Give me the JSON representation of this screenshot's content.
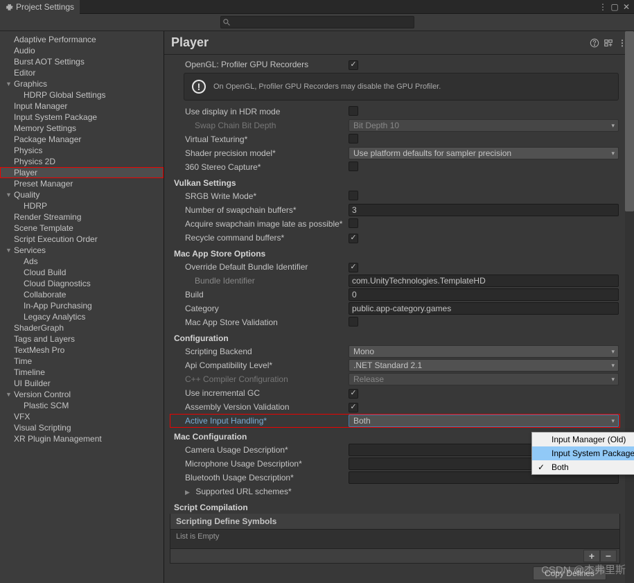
{
  "window": {
    "title": "Project Settings"
  },
  "search": {
    "placeholder": ""
  },
  "sidebar": {
    "items": [
      {
        "label": "Adaptive Performance",
        "indent": 0
      },
      {
        "label": "Audio",
        "indent": 0
      },
      {
        "label": "Burst AOT Settings",
        "indent": 0
      },
      {
        "label": "Editor",
        "indent": 0
      },
      {
        "label": "Graphics",
        "indent": 0,
        "expandable": true
      },
      {
        "label": "HDRP Global Settings",
        "indent": 1
      },
      {
        "label": "Input Manager",
        "indent": 0
      },
      {
        "label": "Input System Package",
        "indent": 0
      },
      {
        "label": "Memory Settings",
        "indent": 0
      },
      {
        "label": "Package Manager",
        "indent": 0
      },
      {
        "label": "Physics",
        "indent": 0
      },
      {
        "label": "Physics 2D",
        "indent": 0
      },
      {
        "label": "Player",
        "indent": 0,
        "selected": true,
        "redbox": true
      },
      {
        "label": "Preset Manager",
        "indent": 0
      },
      {
        "label": "Quality",
        "indent": 0,
        "expandable": true
      },
      {
        "label": "HDRP",
        "indent": 1
      },
      {
        "label": "Render Streaming",
        "indent": 0
      },
      {
        "label": "Scene Template",
        "indent": 0
      },
      {
        "label": "Script Execution Order",
        "indent": 0
      },
      {
        "label": "Services",
        "indent": 0,
        "expandable": true
      },
      {
        "label": "Ads",
        "indent": 1
      },
      {
        "label": "Cloud Build",
        "indent": 1
      },
      {
        "label": "Cloud Diagnostics",
        "indent": 1
      },
      {
        "label": "Collaborate",
        "indent": 1
      },
      {
        "label": "In-App Purchasing",
        "indent": 1
      },
      {
        "label": "Legacy Analytics",
        "indent": 1
      },
      {
        "label": "ShaderGraph",
        "indent": 0
      },
      {
        "label": "Tags and Layers",
        "indent": 0
      },
      {
        "label": "TextMesh Pro",
        "indent": 0
      },
      {
        "label": "Time",
        "indent": 0
      },
      {
        "label": "Timeline",
        "indent": 0
      },
      {
        "label": "UI Builder",
        "indent": 0
      },
      {
        "label": "Version Control",
        "indent": 0,
        "expandable": true
      },
      {
        "label": "Plastic SCM",
        "indent": 1
      },
      {
        "label": "VFX",
        "indent": 0
      },
      {
        "label": "Visual Scripting",
        "indent": 0
      },
      {
        "label": "XR Plugin Management",
        "indent": 0
      }
    ]
  },
  "page": {
    "title": "Player",
    "rows": {
      "opengl_recorders": {
        "label": "OpenGL: Profiler GPU Recorders",
        "checked": true
      },
      "info_msg": "On OpenGL, Profiler GPU Recorders may disable the GPU Profiler.",
      "hdr_mode": {
        "label": "Use display in HDR mode",
        "checked": false
      },
      "swap_chain": {
        "label": "Swap Chain Bit Depth",
        "value": "Bit Depth 10"
      },
      "virtual_tex": {
        "label": "Virtual Texturing*",
        "checked": false
      },
      "shader_prec": {
        "label": "Shader precision model*",
        "value": "Use platform defaults for sampler precision"
      },
      "stereo": {
        "label": "360 Stereo Capture*",
        "checked": false
      },
      "sec_vulkan": "Vulkan Settings",
      "srgb": {
        "label": "SRGB Write Mode*",
        "checked": false
      },
      "swap_buffers": {
        "label": "Number of swapchain buffers*",
        "value": "3"
      },
      "acquire_late": {
        "label": "Acquire swapchain image late as possible*",
        "checked": false
      },
      "recycle": {
        "label": "Recycle command buffers*",
        "checked": true
      },
      "sec_mac": "Mac App Store Options",
      "override_bundle": {
        "label": "Override Default Bundle Identifier",
        "checked": true
      },
      "bundle_id": {
        "label": "Bundle Identifier",
        "value": "com.UnityTechnologies.TemplateHD"
      },
      "build": {
        "label": "Build",
        "value": "0"
      },
      "category": {
        "label": "Category",
        "value": "public.app-category.games"
      },
      "mac_valid": {
        "label": "Mac App Store Validation",
        "checked": false
      },
      "sec_config": "Configuration",
      "scripting": {
        "label": "Scripting Backend",
        "value": "Mono"
      },
      "api_compat": {
        "label": "Api Compatibility Level*",
        "value": ".NET Standard 2.1"
      },
      "cpp_config": {
        "label": "C++ Compiler Configuration",
        "value": "Release"
      },
      "incr_gc": {
        "label": "Use incremental GC",
        "checked": true
      },
      "asm_valid": {
        "label": "Assembly Version Validation",
        "checked": true
      },
      "input_handling": {
        "label": "Active Input Handling*",
        "value": "Both"
      },
      "sec_macconfig": "Mac Configuration",
      "camera_desc": {
        "label": "Camera Usage Description*",
        "value": ""
      },
      "mic_desc": {
        "label": "Microphone Usage Description*",
        "value": ""
      },
      "bt_desc": {
        "label": "Bluetooth Usage Description*",
        "value": ""
      },
      "url_schemes": {
        "label": "Supported URL schemes*"
      },
      "sec_script": "Script Compilation",
      "def_symbols": "Scripting Define Symbols",
      "empty": "List is Empty",
      "copy_btn": "Copy Defines"
    },
    "popup": {
      "items": [
        "Input Manager (Old)",
        "Input System Package (New)",
        "Both"
      ],
      "selected": 2,
      "hover": 1
    }
  },
  "watermark": "CSDN @杰弗里斯"
}
